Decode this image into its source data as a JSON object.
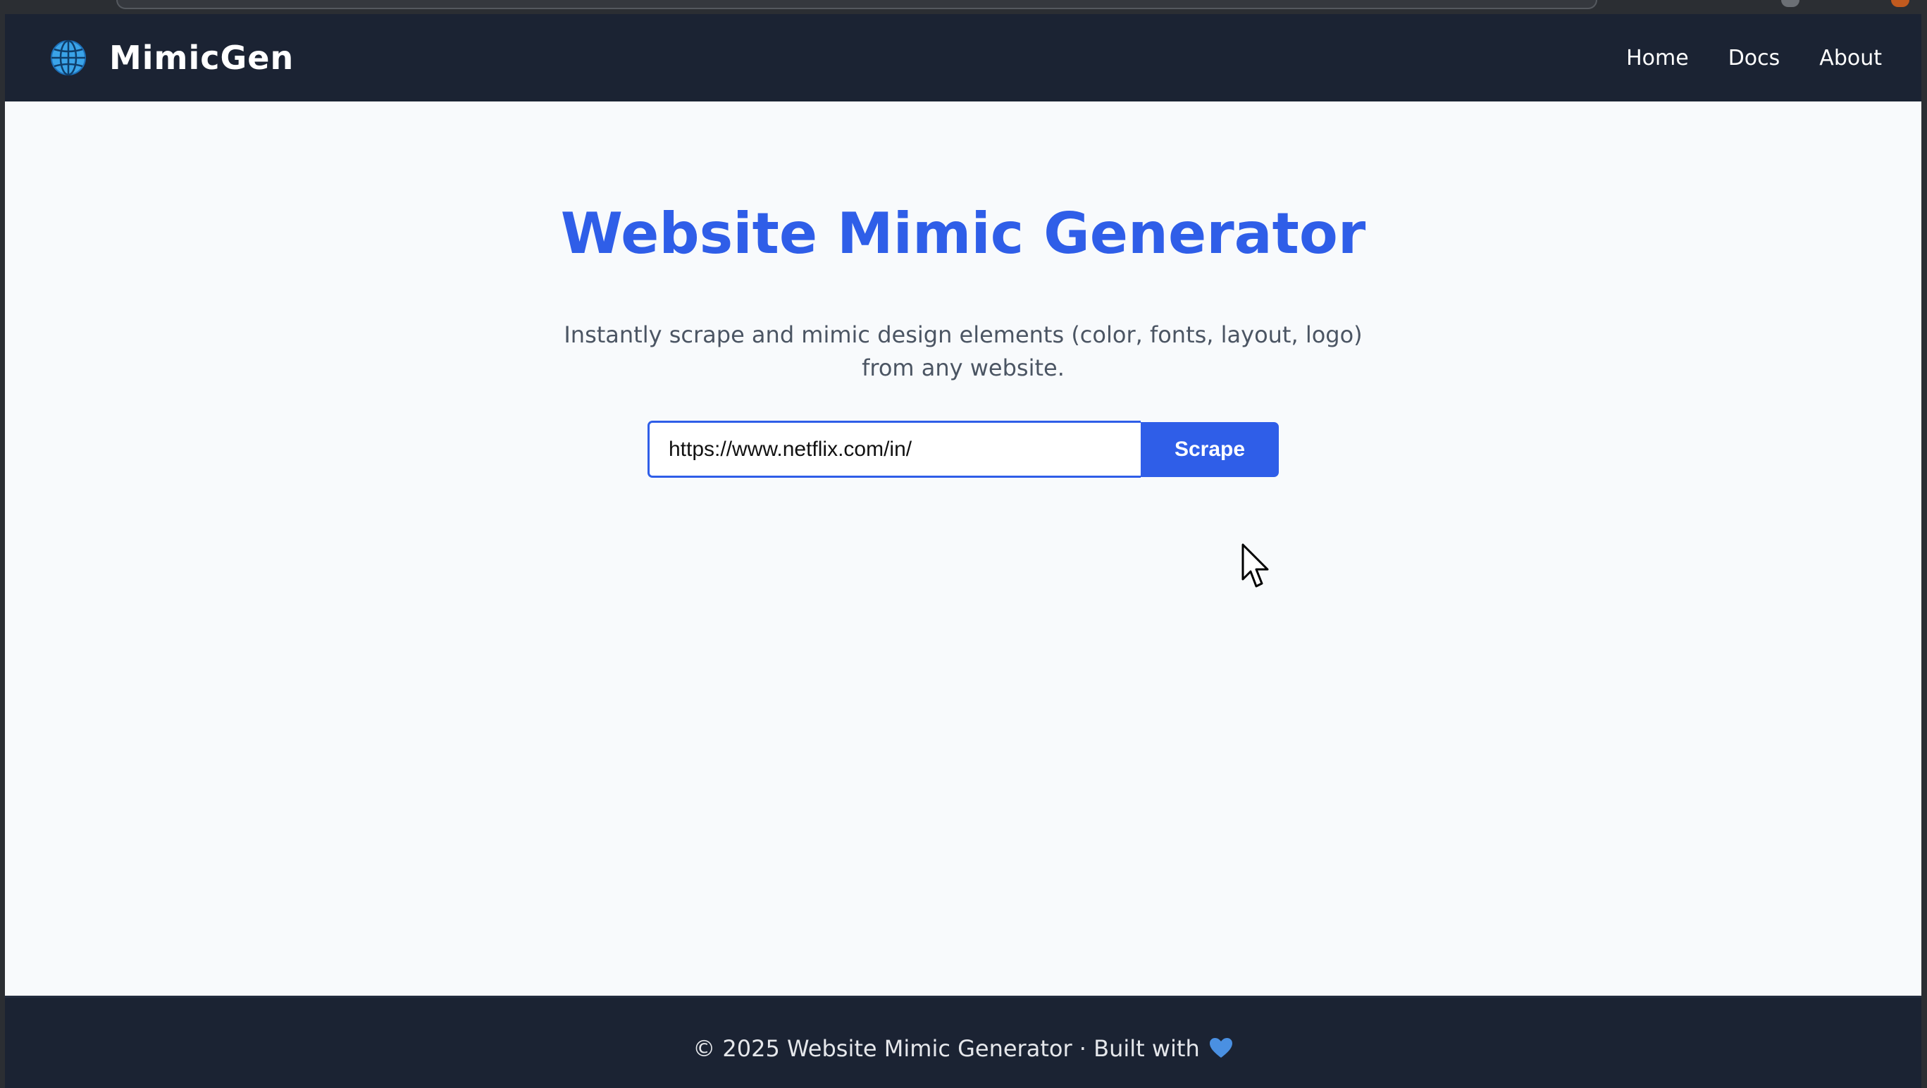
{
  "brand": {
    "name": "MimicGen",
    "icon": "globe-icon"
  },
  "nav": {
    "items": [
      {
        "label": "Home"
      },
      {
        "label": "Docs"
      },
      {
        "label": "About"
      }
    ]
  },
  "hero": {
    "title": "Website Mimic Generator",
    "subtitle": "Instantly scrape and mimic design elements (color, fonts, layout, logo) from any website."
  },
  "form": {
    "url_value": "https://www.netflix.com/in/",
    "button_label": "Scrape"
  },
  "footer": {
    "text": "© 2025 Website Mimic Generator · Built with",
    "icon": "blue-heart-icon"
  },
  "colors": {
    "accent": "#2f5ee8",
    "navbar": "#1b2333",
    "background": "#f8fafc",
    "globe": "#3aa3e8",
    "heart": "#4a90e2"
  }
}
